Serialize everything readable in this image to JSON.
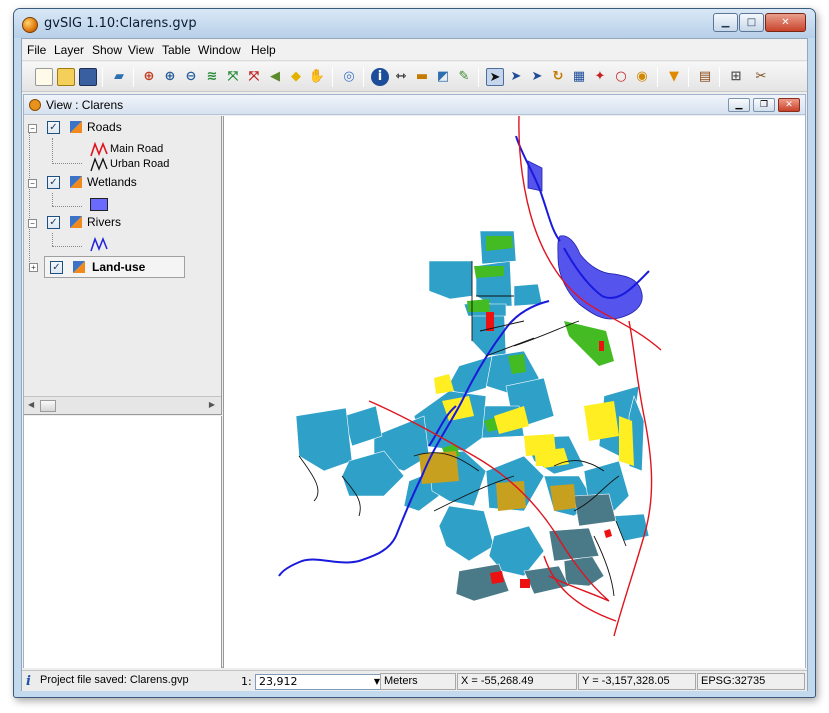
{
  "window": {
    "title": "gvSIG 1.10:Clarens.gvp"
  },
  "menu": [
    "File",
    "Layer",
    "Show",
    "View",
    "Table",
    "Window",
    "Help"
  ],
  "view": {
    "title": "View : Clarens"
  },
  "toc": {
    "layers": [
      {
        "name": "Roads",
        "checked": true,
        "legend": [
          {
            "label": "Main Road",
            "color": "#e0141e"
          },
          {
            "label": "Urban Road",
            "color": "#111111"
          }
        ]
      },
      {
        "name": "Wetlands",
        "checked": true,
        "legend_color": "#6a6aff"
      },
      {
        "name": "Rivers",
        "checked": true,
        "legend_color": "#2222dd"
      },
      {
        "name": "Land-use",
        "checked": true,
        "selected": true
      }
    ]
  },
  "status": {
    "message": "Project file saved: Clarens.gvp",
    "scale_prefix": "1:",
    "scale_value": "23,912",
    "units": "Meters",
    "x": "X = -55,268.49",
    "y": "Y = -3,157,328.05",
    "epsg": "EPSG:32735"
  },
  "colors": {
    "landuse_residential": "#2fa0c8",
    "landuse_dark": "#4a7a88",
    "landuse_green": "#44bb22",
    "landuse_yellow": "#ffee22",
    "landuse_olive": "#c8a020",
    "landuse_red": "#ee1111",
    "wetlands": "#5555ee",
    "rivers": "#1a1add",
    "main_road": "#e0141e"
  }
}
